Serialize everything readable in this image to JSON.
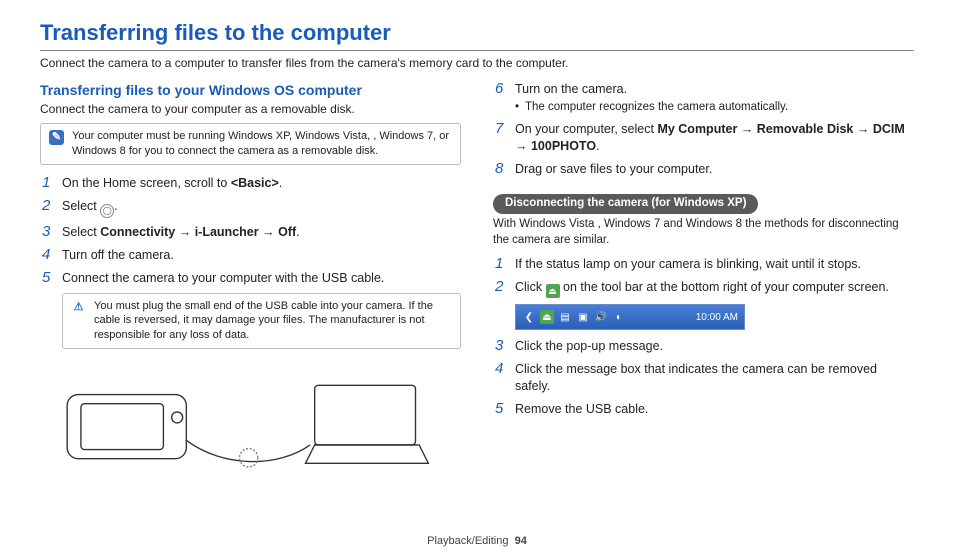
{
  "page": {
    "title": "Transferring files to the computer",
    "intro": "Connect the camera to a computer to transfer files from the camera's memory card to the computer.",
    "footer_section": "Playback/Editing",
    "page_number": "94"
  },
  "left": {
    "section_title": "Transferring files to your Windows OS computer",
    "section_sub": "Connect the camera to your computer as a removable disk.",
    "info_note": "Your computer must be running Windows XP, Windows Vista, , Windows 7, or Windows 8 for you to connect the camera as a removable disk.",
    "steps": {
      "s1_a": "On the Home screen, scroll to ",
      "s1_b": "<Basic>",
      "s1_c": ".",
      "s2_a": "Select ",
      "s2_b": ".",
      "s3_a": "Select ",
      "s3_b": "Connectivity",
      "s3_c": "i-Launcher",
      "s3_d": "Off",
      "s3_e": ".",
      "s4": "Turn off the camera.",
      "s5": "Connect the camera to your computer with the USB cable."
    },
    "warn_note": "You must plug the small end of the USB cable into your camera. If the cable is reversed, it may damage your files. The manufacturer is not responsible for any loss of data."
  },
  "right": {
    "steps_a": {
      "s6": "Turn on the camera.",
      "s6_sub": "The computer recognizes the camera automatically.",
      "s7_a": "On your computer, select ",
      "s7_b": "My Computer",
      "s7_c": "Removable Disk",
      "s7_d": "DCIM",
      "s7_e": "100PHOTO",
      "s7_f": ".",
      "s8": "Drag or save files to your computer."
    },
    "pill": "Disconnecting the camera (for Windows XP)",
    "pill_sub": "With Windows Vista , Windows 7 and Windows 8 the methods for disconnecting the camera are similar.",
    "steps_b": {
      "s1": "If the status lamp on your camera is blinking, wait until it stops.",
      "s2_a": "Click ",
      "s2_b": " on the tool bar at the bottom right of your computer screen.",
      "s3": "Click the pop-up message.",
      "s4": "Click the message box that indicates the camera can be removed safely.",
      "s5": "Remove the USB cable."
    },
    "taskbar_time": "10:00 AM"
  }
}
